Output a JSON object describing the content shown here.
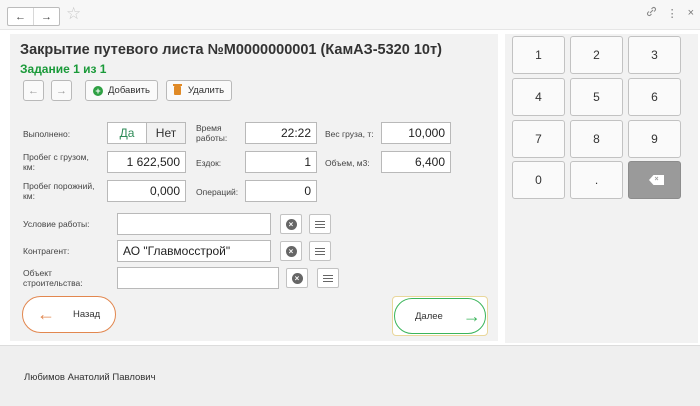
{
  "topbar": {
    "back_glyph": "←",
    "forward_glyph": "→",
    "star_glyph": "☆",
    "link_glyph": "🔗",
    "menu_glyph": "⋮",
    "close_glyph": "×"
  },
  "doc": {
    "title": "Закрытие путевого листа №М0000000001 (КамАЗ-5320 10т)",
    "subtitle": "Задание 1 из 1"
  },
  "toolbar": {
    "back_glyph": "←",
    "forward_glyph": "→",
    "add_label": "Добавить",
    "delete_label": "Удалить"
  },
  "form": {
    "done_label": "Выполнено:",
    "done_yes": "Да",
    "done_no": "Нет",
    "time_label": "Время работы:",
    "time_value": "22:22",
    "cargo_label": "Вес груза, т:",
    "cargo_value": "10,000",
    "mileage_loaded_label": "Пробег с грузом, км:",
    "mileage_loaded_value": "1 622,500",
    "trips_label": "Ездок:",
    "trips_value": "1",
    "volume_label": "Объем, м3:",
    "volume_value": "6,400",
    "mileage_empty_label": "Пробег порожний, км:",
    "mileage_empty_value": "0,000",
    "operations_label": "Операций:",
    "operations_value": "0",
    "work_condition_label": "Условие работы:",
    "work_condition_value": "",
    "counterparty_label": "Контрагент:",
    "counterparty_value": "АО \"Главмосстрой\"",
    "site_label": "Объект строительства:",
    "site_value": ""
  },
  "nav": {
    "back_label": "Назад",
    "next_label": "Далее"
  },
  "keypad": {
    "keys": [
      "1",
      "2",
      "3",
      "4",
      "5",
      "6",
      "7",
      "8",
      "9",
      "0",
      "."
    ]
  },
  "footer": {
    "user": "Любимов Анатолий Павлович"
  },
  "colors": {
    "accent_green": "#1a9a39",
    "back_orange": "#e2874f",
    "next_green": "#3bb55b"
  }
}
